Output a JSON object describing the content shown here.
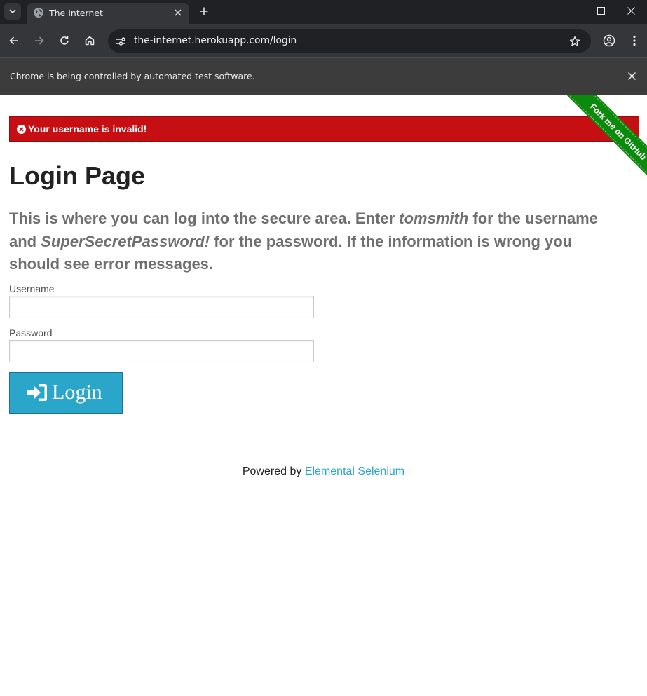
{
  "browser": {
    "tab_title": "The Internet",
    "url": "the-internet.herokuapp.com/login",
    "infobar_text": "Chrome is being controlled by automated test software."
  },
  "flash": {
    "message": "Your username is invalid!",
    "color": "#c60f13"
  },
  "ribbon": {
    "text": "Fork me on GitHub",
    "color": "#0c8a0c"
  },
  "page": {
    "title": "Login Page",
    "subheader_part1": "This is where you can log into the secure area. Enter ",
    "subheader_user": "tomsmith",
    "subheader_part2": " for the username and ",
    "subheader_pass": "SuperSecretPassword!",
    "subheader_part3": " for the password. If the information is wrong you should see error messages."
  },
  "form": {
    "username_label": "Username",
    "username_value": "",
    "password_label": "Password",
    "password_value": "",
    "login_label": "Login",
    "button_color": "#2ba6cb"
  },
  "footer": {
    "prefix": "Powered by ",
    "link_text": "Elemental Selenium",
    "link_color": "#2ba6cb"
  }
}
